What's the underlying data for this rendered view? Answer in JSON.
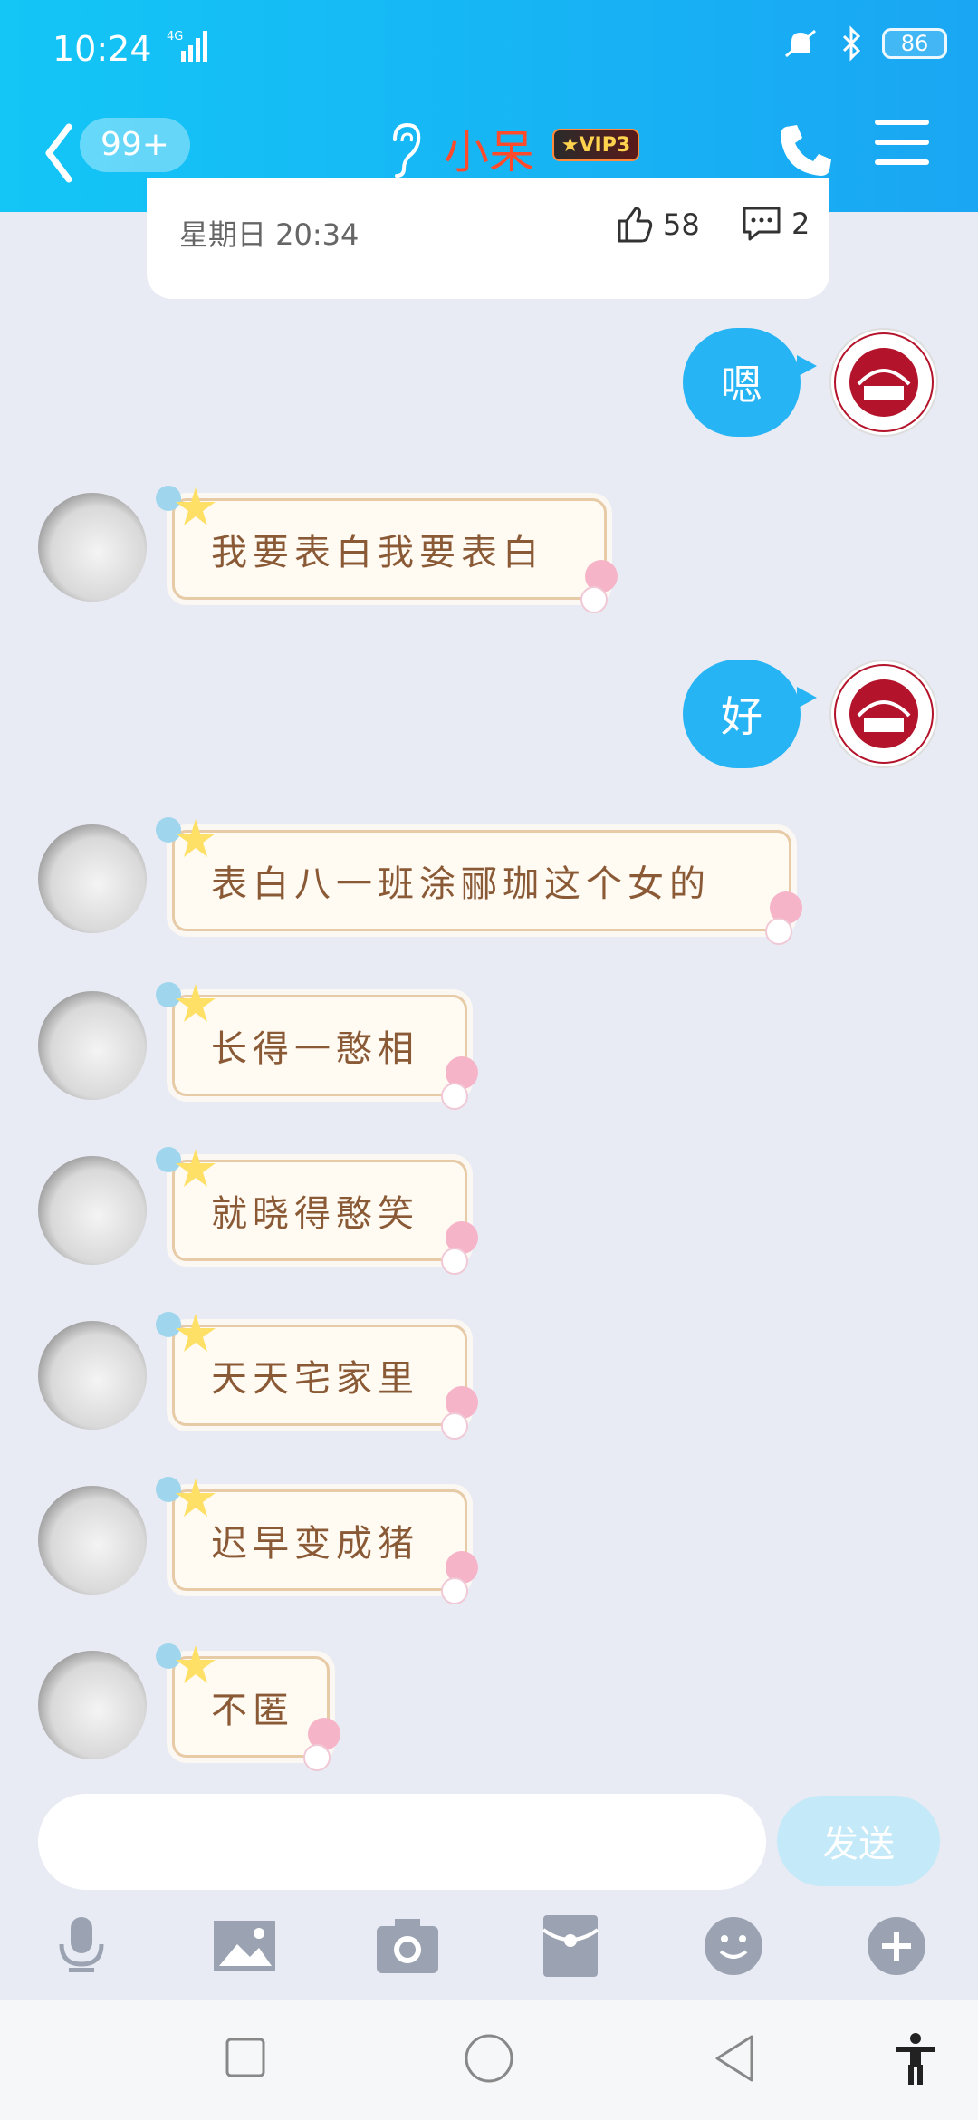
{
  "statusbar": {
    "time": "10:24",
    "network": "4G",
    "battery": "86"
  },
  "header": {
    "badge": "99+",
    "title": "小呆",
    "vip": "VIP3"
  },
  "feed_card": {
    "date": "星期日 20:34",
    "likes": "58",
    "comments": "2"
  },
  "messages": {
    "me1": "嗯",
    "them1": "我要表白我要表白",
    "me2": "好",
    "them2": "表白八一班涂郦珈这个女的",
    "them3": "长得一憨相",
    "them4": "就晓得憨笑",
    "them5": "天天宅家里",
    "them6": "迟早变成猪",
    "them7": "不匿"
  },
  "input": {
    "placeholder": "",
    "send_label": "发送"
  },
  "colors": {
    "accent": "#1aa6f3",
    "title": "#ff4b2b",
    "bubble_me": "#27b4f5",
    "bubble_them_text": "#8a5a36"
  },
  "icons": {
    "toolbar": [
      "microphone-icon",
      "image-icon",
      "camera-icon",
      "red-packet-icon",
      "emoji-icon",
      "plus-icon"
    ],
    "nav": [
      "square-icon",
      "circle-icon",
      "triangle-back-icon",
      "accessibility-icon"
    ]
  }
}
